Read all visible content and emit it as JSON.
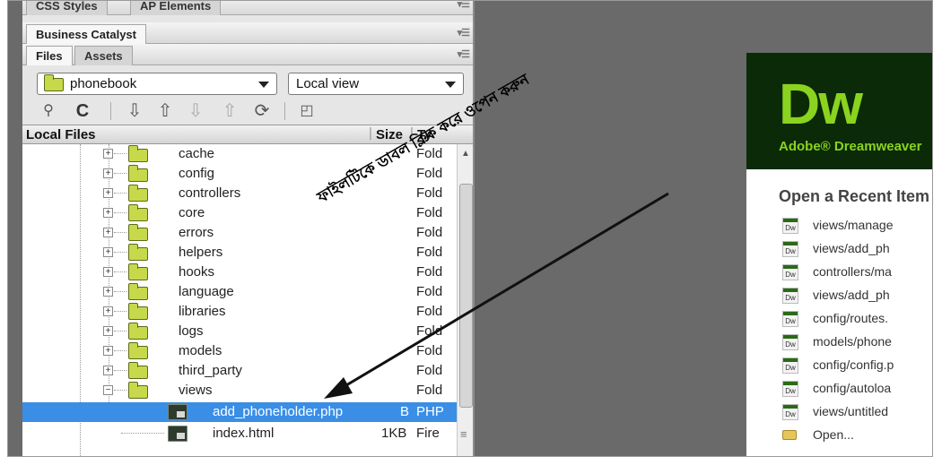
{
  "panel": {
    "top_tabs": [
      "CSS Styles",
      "AP Elements"
    ],
    "business_catalyst_tab": "Business Catalyst",
    "files_tabs": [
      "Files",
      "Assets"
    ],
    "site_select": "phonebook",
    "view_select": "Local view",
    "column_local_files": "Local Files",
    "column_size": "Size",
    "column_type": "Ty",
    "toolbar_icons": [
      "connect-icon",
      "refresh-icon",
      "get-files-icon",
      "put-files-icon",
      "check-out-icon",
      "check-in-icon",
      "synchronize-icon",
      "expand-icon"
    ]
  },
  "files": [
    {
      "name": "cache",
      "type": "Fold",
      "kind": "folder"
    },
    {
      "name": "config",
      "type": "Fold",
      "kind": "folder"
    },
    {
      "name": "controllers",
      "type": "Fold",
      "kind": "folder"
    },
    {
      "name": "core",
      "type": "Fold",
      "kind": "folder"
    },
    {
      "name": "errors",
      "type": "Fold",
      "kind": "folder"
    },
    {
      "name": "helpers",
      "type": "Fold",
      "kind": "folder"
    },
    {
      "name": "hooks",
      "type": "Fold",
      "kind": "folder"
    },
    {
      "name": "language",
      "type": "Fold",
      "kind": "folder"
    },
    {
      "name": "libraries",
      "type": "Fold",
      "kind": "folder"
    },
    {
      "name": "logs",
      "type": "Fold",
      "kind": "folder"
    },
    {
      "name": "models",
      "type": "Fold",
      "kind": "folder"
    },
    {
      "name": "third_party",
      "type": "Fold",
      "kind": "folder"
    },
    {
      "name": "views",
      "type": "Fold",
      "kind": "folder-open"
    },
    {
      "name": "add_phoneholder.php",
      "size": "B",
      "type": "PHP",
      "kind": "file",
      "selected": true
    },
    {
      "name": "index.html",
      "size": "1KB",
      "type": "Fire",
      "kind": "file"
    }
  ],
  "splash": {
    "logo": "Dw",
    "product": "Adobe® Dreamweaver",
    "recent_title": "Open a Recent Item",
    "recent_items": [
      "views/manage",
      "views/add_ph",
      "controllers/ma",
      "views/add_ph",
      "config/routes.",
      "models/phone",
      "config/config.p",
      "config/autoloa",
      "views/untitled"
    ],
    "open_label": "Open..."
  },
  "annotation": "ফাইলটিকে ডাবল ক্লিক করে ওপেন করুন"
}
